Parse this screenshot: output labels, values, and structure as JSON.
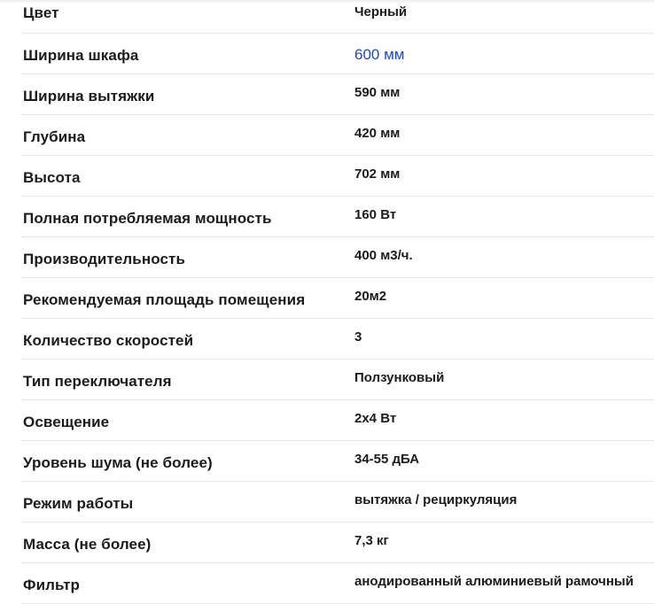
{
  "specs": [
    {
      "label": "Цвет",
      "value": "Черный"
    },
    {
      "label": "Ширина шкафа",
      "value": "600 мм"
    },
    {
      "label": "Ширина вытяжки",
      "value": "590 мм"
    },
    {
      "label": "Глубина",
      "value": "420 мм"
    },
    {
      "label": "Высота",
      "value": "702 мм"
    },
    {
      "label": "Полная потребляемая мощность",
      "value": "160 Вт"
    },
    {
      "label": "Производительность",
      "value": "400 м3/ч."
    },
    {
      "label": "Рекомендуемая площадь помещения",
      "value": "20м2"
    },
    {
      "label": "Количество скоростей",
      "value": "3"
    },
    {
      "label": "Тип переключателя",
      "value": "Ползунковый"
    },
    {
      "label": "Освещение",
      "value": "2х4 Вт"
    },
    {
      "label": "Уровень шума (не более)",
      "value": "34-55 дБА"
    },
    {
      "label": "Режим работы",
      "value": "вытяжка / рециркуляция"
    },
    {
      "label": "Масса (не более)",
      "value": "7,3 кг"
    },
    {
      "label": "Фильтр",
      "value": "анодированный алюминиевый рамочный"
    }
  ],
  "colors": {
    "link": "#1f49b6",
    "text": "#1b1b1b",
    "divider": "#e6e6e6"
  }
}
